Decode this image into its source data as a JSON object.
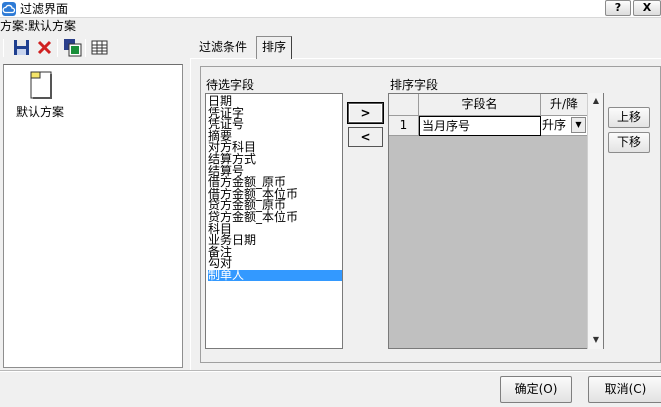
{
  "window": {
    "title": "过滤界面",
    "help_label": "?",
    "close_label": "X"
  },
  "scheme": {
    "label": "方案:",
    "current": "默认方案"
  },
  "toolbar": {
    "icons": [
      "save-icon",
      "delete-icon",
      "save-as-icon",
      "grid-icon"
    ]
  },
  "scheme_list": {
    "items": [
      {
        "name": "默认方案"
      }
    ]
  },
  "tabs": {
    "filter": "过滤条件",
    "sort": "排序",
    "active": "排序"
  },
  "candidate": {
    "label": "待选字段",
    "items": [
      "日期",
      "凭证字",
      "凭证号",
      "摘要",
      "对方科目",
      "结算方式",
      "结算号",
      "借方金额_原币",
      "借方金额_本位币",
      "贷方金额_原币",
      "贷方金额_本位币",
      "科目",
      "业务日期",
      "备注",
      "勾对",
      "制单人"
    ],
    "selected": "制单人"
  },
  "arrows": {
    "add": ">",
    "remove": "<"
  },
  "sort": {
    "label": "排序字段",
    "columns": [
      "字段名",
      "升/降"
    ],
    "rows": [
      {
        "index": "1",
        "field": "当月序号",
        "order": "升序"
      }
    ]
  },
  "buttons": {
    "up": "上移",
    "down": "下移",
    "ok": "确定(O)",
    "cancel": "取消(C)"
  },
  "colors": {
    "selection": "#3399ff",
    "grid_bg": "#c0c0c0",
    "window_bg": "#f0f0f0"
  }
}
